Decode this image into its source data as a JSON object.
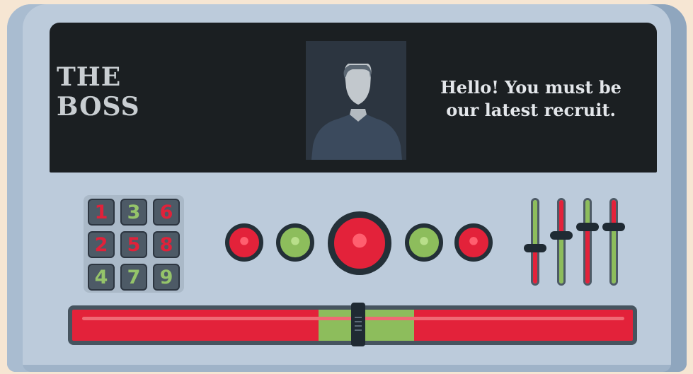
{
  "screen": {
    "character_name": "THE BOSS",
    "dialogue_line1": "Hello! You must be",
    "dialogue_line2": "our latest recruit.",
    "portrait_icon": "person-silhouette-icon"
  },
  "keypad": {
    "keys": [
      {
        "label": "1",
        "color": "red"
      },
      {
        "label": "3",
        "color": "green"
      },
      {
        "label": "6",
        "color": "red"
      },
      {
        "label": "2",
        "color": "red"
      },
      {
        "label": "5",
        "color": "red"
      },
      {
        "label": "8",
        "color": "red"
      },
      {
        "label": "4",
        "color": "green"
      },
      {
        "label": "7",
        "color": "green"
      },
      {
        "label": "9",
        "color": "green"
      }
    ]
  },
  "buttons": [
    "red",
    "green",
    "red-large",
    "green",
    "red"
  ],
  "sliders": [
    {
      "fill": "green-top-red-bottom",
      "level": 0.4
    },
    {
      "fill": "red-top-green-bottom",
      "level": 0.55
    },
    {
      "fill": "green-top-red-bottom",
      "level": 0.65
    },
    {
      "fill": "red-top-green-bottom",
      "level": 0.65
    }
  ],
  "progress_bar": {
    "green_zone_start": 0.44,
    "green_zone_end": 0.61,
    "handle_position": 0.51
  },
  "colors": {
    "red": "#e3223a",
    "green": "#8dbd5c",
    "screen": "#1b1f22",
    "panel": "#bccbdb"
  }
}
